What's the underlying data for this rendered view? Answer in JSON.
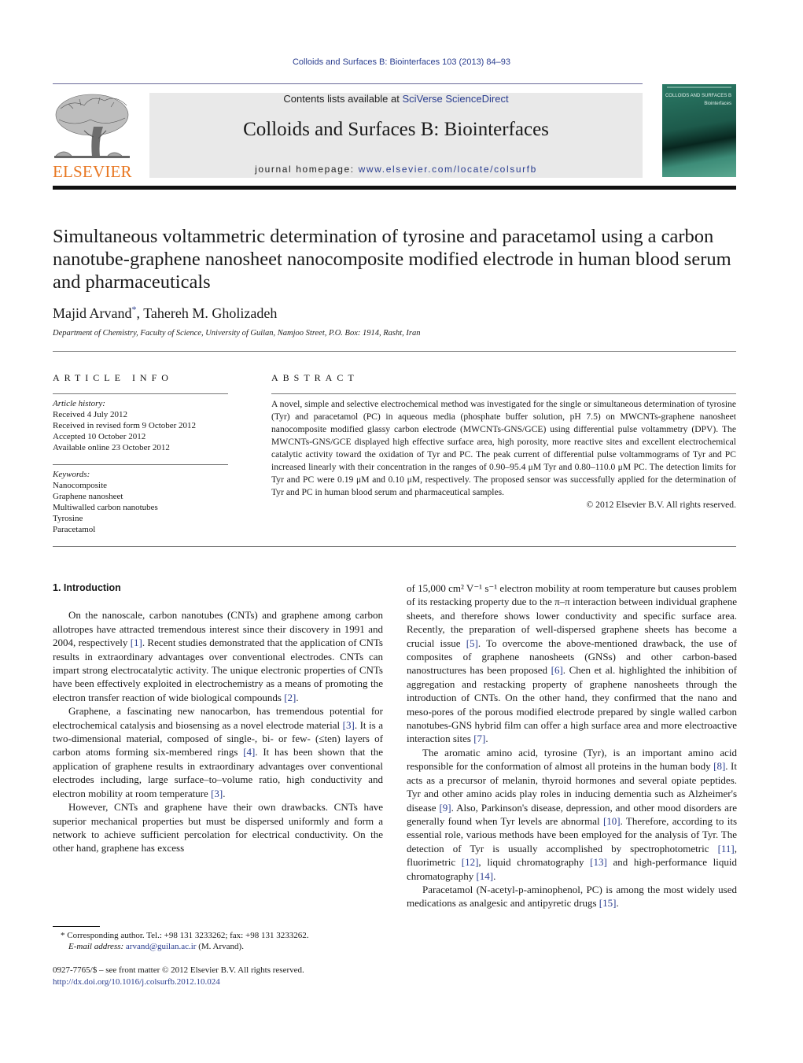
{
  "running_head": "Colloids and Surfaces B: Biointerfaces 103 (2013) 84–93",
  "masthead": {
    "contents_prefix": "Contents lists available at ",
    "contents_link": "SciVerse ScienceDirect",
    "journal_title": "Colloids and Surfaces B: Biointerfaces",
    "homepage_prefix": "journal homepage: ",
    "homepage_link": "www.elsevier.com/locate/colsurfb",
    "publisher_logo_text": "ELSEVIER",
    "cover_title": "COLLOIDS AND SURFACES B",
    "cover_subtitle": "Biointerfaces",
    "colors": {
      "elsevier_orange": "#e87722",
      "link_blue": "#2a3d8f",
      "masthead_bg": "#e9e9e9",
      "cover_green": "#1d5a4b"
    }
  },
  "article": {
    "title": "Simultaneous voltammetric determination of tyrosine and paracetamol using a carbon nanotube-graphene nanosheet nanocomposite modified electrode in human blood serum and pharmaceuticals",
    "authors": [
      {
        "name": "Majid Arvand",
        "mark": "*"
      },
      {
        "name": "Tahereh M. Gholizadeh",
        "mark": ""
      }
    ],
    "author_separator": ", ",
    "affiliation": "Department of Chemistry, Faculty of Science, University of Guilan, Namjoo Street, P.O. Box: 1914, Rasht, Iran"
  },
  "article_info": {
    "heading": "ARTICLE INFO",
    "history_label": "Article history:",
    "history": [
      "Received 4 July 2012",
      "Received in revised form 9 October 2012",
      "Accepted 10 October 2012",
      "Available online 23 October 2012"
    ],
    "keywords_label": "Keywords:",
    "keywords": [
      "Nanocomposite",
      "Graphene nanosheet",
      "Multiwalled carbon nanotubes",
      "Tyrosine",
      "Paracetamol"
    ]
  },
  "abstract": {
    "heading": "ABSTRACT",
    "text": "A novel, simple and selective electrochemical method was investigated for the single or simultaneous determination of tyrosine (Tyr) and paracetamol (PC) in aqueous media (phosphate buffer solution, pH 7.5) on MWCNTs-graphene nanosheet nanocomposite modified glassy carbon electrode (MWCNTs-GNS/GCE) using differential pulse voltammetry (DPV). The MWCNTs-GNS/GCE displayed high effective surface area, high porosity, more reactive sites and excellent electrochemical catalytic activity toward the oxidation of Tyr and PC. The peak current of differential pulse voltammograms of Tyr and PC increased linearly with their concentration in the ranges of 0.90–95.4 μM Tyr and 0.80–110.0 μM PC. The detection limits for Tyr and PC were 0.19 μM and 0.10 μM, respectively. The proposed sensor was successfully applied for the determination of Tyr and PC in human blood serum and pharmaceutical samples.",
    "copyright": "© 2012 Elsevier B.V. All rights reserved."
  },
  "body": {
    "section_heading": "1.  Introduction",
    "left_paragraphs": [
      [
        {
          "t": "On the nanoscale, carbon nanotubes (CNTs) and graphene among carbon allotropes have attracted tremendous interest since their discovery in 1991 and 2004, respectively "
        },
        {
          "ref": "[1]"
        },
        {
          "t": ". Recent studies demonstrated that the application of CNTs results in extraordinary advantages over conventional electrodes. CNTs can impart strong electrocatalytic activity. The unique electronic properties of CNTs have been effectively exploited in electrochemistry as a means of promoting the electron transfer reaction of wide biological compounds "
        },
        {
          "ref": "[2]"
        },
        {
          "t": "."
        }
      ],
      [
        {
          "t": "Graphene, a fascinating new nanocarbon, has tremendous potential for electrochemical catalysis and biosensing as a novel electrode material "
        },
        {
          "ref": "[3]"
        },
        {
          "t": ". It is a two-dimensional material, composed of single-, bi- or few- (≤ten) layers of carbon atoms forming six-membered rings "
        },
        {
          "ref": "[4]"
        },
        {
          "t": ". It has been shown that the application of graphene results in extraordinary advantages over conventional electrodes including, large surface–to–volume ratio, high conductivity and electron mobility at room temperature "
        },
        {
          "ref": "[3]"
        },
        {
          "t": "."
        }
      ],
      [
        {
          "t": "However, CNTs and graphene have their own drawbacks. CNTs have superior mechanical properties but must be dispersed uniformly and form a network to achieve sufficient percolation for electrical conductivity. On the other hand, graphene has excess"
        }
      ]
    ],
    "right_paragraphs": [
      [
        {
          "t": "of 15,000 cm² V⁻¹ s⁻¹ electron mobility at room temperature but causes problem of its restacking property due to the π–π interaction between individual graphene sheets, and therefore shows lower conductivity and specific surface area. Recently, the preparation of well-dispersed graphene sheets has become a crucial issue "
        },
        {
          "ref": "[5]"
        },
        {
          "t": ". To overcome the above-mentioned drawback, the use of composites of graphene nanosheets (GNSs) and other carbon-based nanostructures has been proposed "
        },
        {
          "ref": "[6]"
        },
        {
          "t": ". Chen et al. highlighted the inhibition of aggregation and restacking property of graphene nanosheets through the introduction of CNTs. On the other hand, they confirmed that the nano and meso-pores of the porous modified electrode prepared by single walled carbon nanotubes-GNS hybrid film can offer a high surface area and more electroactive interaction sites "
        },
        {
          "ref": "[7]"
        },
        {
          "t": "."
        }
      ],
      [
        {
          "t": "The aromatic amino acid, tyrosine (Tyr), is an important amino acid responsible for the conformation of almost all proteins in the human body "
        },
        {
          "ref": "[8]"
        },
        {
          "t": ". It acts as a precursor of melanin, thyroid hormones and several opiate peptides. Tyr and other amino acids play roles in inducing dementia such as Alzheimer's disease "
        },
        {
          "ref": "[9]"
        },
        {
          "t": ". Also, Parkinson's disease, depression, and other mood disorders are generally found when Tyr levels are abnormal "
        },
        {
          "ref": "[10]"
        },
        {
          "t": ". Therefore, according to its essential role, various methods have been employed for the analysis of Tyr. The detection of Tyr is usually accomplished by spectrophotometric "
        },
        {
          "ref": "[11]"
        },
        {
          "t": ", fluorimetric "
        },
        {
          "ref": "[12]"
        },
        {
          "t": ", liquid chromatography "
        },
        {
          "ref": "[13]"
        },
        {
          "t": " and high-performance liquid chromatography "
        },
        {
          "ref": "[14]"
        },
        {
          "t": "."
        }
      ],
      [
        {
          "t": "Paracetamol (N-acetyl-p-aminophenol, PC) is among the most widely used medications as analgesic and antipyretic drugs "
        },
        {
          "ref": "[15]"
        },
        {
          "t": "."
        }
      ]
    ]
  },
  "footnote": {
    "mark": "*",
    "corresponding": "Corresponding author. Tel.: +98 131 3233262; fax: +98 131 3233262.",
    "email_label": "E-mail address:",
    "email": "arvand@guilan.ac.ir",
    "email_suffix": " (M. Arvand)."
  },
  "front_matter": {
    "issn_line": "0927-7765/$ – see front matter © 2012 Elsevier B.V. All rights reserved.",
    "doi_link": "http://dx.doi.org/10.1016/j.colsurfb.2012.10.024"
  }
}
